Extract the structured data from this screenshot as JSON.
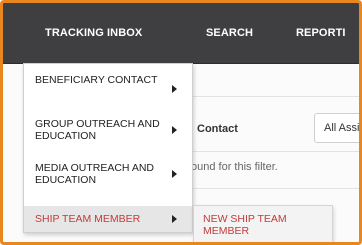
{
  "navbar": {
    "items": [
      {
        "label": "TRACKING INBOX"
      },
      {
        "label": "SEARCH"
      },
      {
        "label": "REPORTI"
      }
    ]
  },
  "content": {
    "contact_label": "Contact",
    "assign_select": "All Assign",
    "no_results_text": "ound for this filter."
  },
  "dropdown": {
    "items": [
      {
        "label": "BENEFICIARY CONTACT",
        "icon": "chevron-right-icon"
      },
      {
        "label": "GROUP OUTREACH AND EDUCATION",
        "icon": "chevron-right-icon"
      },
      {
        "label": "MEDIA OUTREACH AND EDUCATION",
        "icon": "chevron-right-icon"
      },
      {
        "label": "SHIP TEAM MEMBER",
        "icon": "chevron-right-icon",
        "active": true
      }
    ],
    "submenu": {
      "items": [
        {
          "label": "NEW SHIP TEAM MEMBER"
        }
      ]
    }
  },
  "colors": {
    "navbar_bg": "#3f3f42",
    "frame_border": "#e8871e",
    "active_text": "#c23b3b",
    "active_bg": "#e6e6e6"
  }
}
